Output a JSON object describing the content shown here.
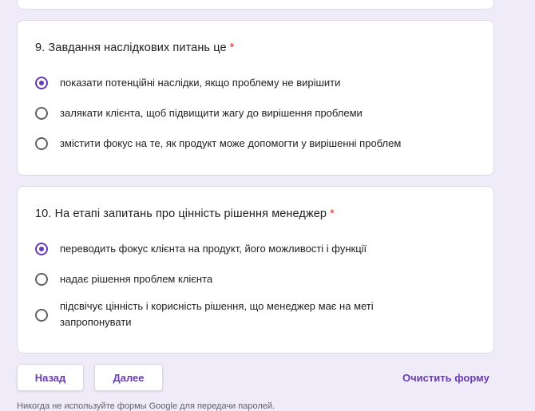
{
  "questions": [
    {
      "title": "9. Завдання наслідкових питань це",
      "required_mark": "*",
      "options": [
        {
          "label": "показати потенційні наслідки, якщо проблему не вирішити",
          "selected": true
        },
        {
          "label": "залякати клієнта, щоб підвищити жагу до вирішення проблеми",
          "selected": false
        },
        {
          "label": "змістити фокус на те, як продукт може допомогти у вирішенні проблем",
          "selected": false
        }
      ]
    },
    {
      "title": "10. На етапі запитань про цінність рішення менеджер",
      "required_mark": "*",
      "options": [
        {
          "label": "переводить фокус клієнта на продукт, його можливості і функції",
          "selected": true
        },
        {
          "label": "надає рішення проблем клієнта",
          "selected": false
        },
        {
          "label": "підсвічує цінність і корисність рішення, що менеджер має на меті",
          "label_line2": "запропонувати",
          "selected": false
        }
      ]
    }
  ],
  "nav": {
    "back_label": "Назад",
    "next_label": "Далее",
    "clear_label": "Очистить форму"
  },
  "footer": {
    "note": "Никогда не используйте формы Google для передачи паролей."
  },
  "colors": {
    "accent": "#673ab7",
    "background": "#f0ebf8",
    "required": "#d93025"
  }
}
